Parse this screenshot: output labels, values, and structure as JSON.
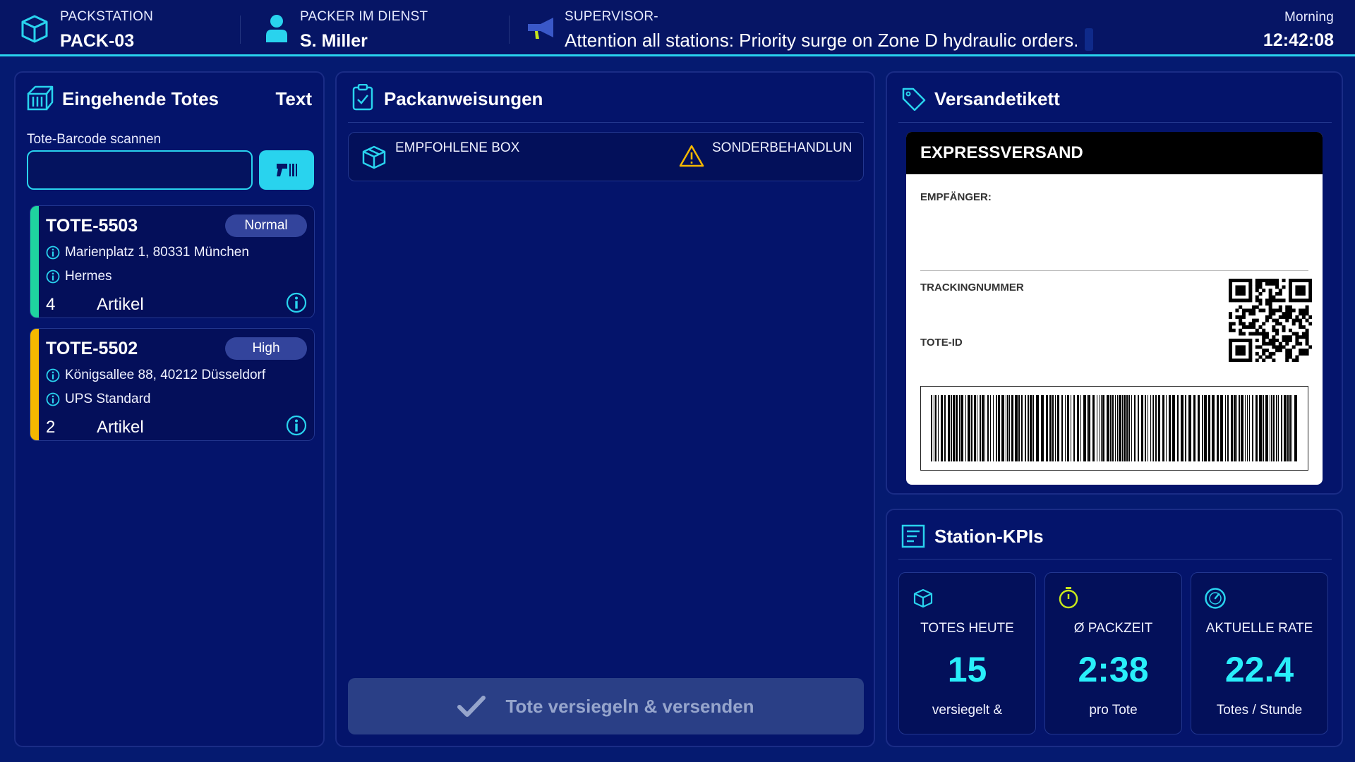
{
  "header": {
    "station_label": "PACKSTATION",
    "station_value": "PACK-03",
    "packer_label": "PACKER IM DIENST",
    "packer_value": "S. Miller",
    "supervisor_label": "SUPERVISOR-",
    "supervisor_message": "Attention all stations: Priority surge on Zone D hydraulic orders.",
    "shift_label": "Morning",
    "clock": "12:42:08",
    "icons": {
      "station": "box-icon",
      "packer": "user-icon",
      "supervisor": "megaphone-icon"
    }
  },
  "totes_panel": {
    "title": "Eingehende Totes",
    "title_right": "Text",
    "scan_label": "Tote-Barcode scannen",
    "scan_value": "",
    "scan_placeholder": "",
    "totes": [
      {
        "id": "TOTE-5503",
        "priority": "Normal",
        "address": "Marienplatz 1, 80331 München",
        "carrier": "Hermes",
        "count": "4",
        "unit": "Artikel",
        "stripe_color": "#1fd39f"
      },
      {
        "id": "TOTE-5502",
        "priority": "High",
        "address": "Königsallee 88, 40212 Düsseldorf",
        "carrier": "UPS Standard",
        "count": "2",
        "unit": "Artikel",
        "stripe_color": "#f5b800"
      }
    ]
  },
  "instructions_panel": {
    "title": "Packanweisungen",
    "box_label": "EMPFOHLENE BOX",
    "special_label": "SONDERBEHANDLUN",
    "seal_button": "Tote versiegeln & versenden"
  },
  "label_panel": {
    "title": "Versandetikett",
    "header": "EXPRESSVERSAND",
    "recipient_label": "EMPFÄNGER:",
    "tracking_label": "TRACKINGNUMMER",
    "tote_label": "TOTE-ID"
  },
  "kpi_panel": {
    "title": "Station-KPIs",
    "kpis": [
      {
        "label": "TOTES HEUTE",
        "value": "15",
        "sub": "versiegelt &",
        "icon": "box-icon"
      },
      {
        "label": "Ø PACKZEIT",
        "value": "2:38",
        "sub": "pro Tote",
        "icon": "stopwatch-icon"
      },
      {
        "label": "AKTUELLE RATE",
        "value": "22.4",
        "sub": "Totes / Stunde",
        "icon": "gauge-icon"
      }
    ]
  },
  "colors": {
    "background": "#051a70",
    "accent": "#29d3ee",
    "kpi_value": "#29eefa",
    "warning": "#f5b800",
    "normal_stripe": "#1fd39f"
  }
}
